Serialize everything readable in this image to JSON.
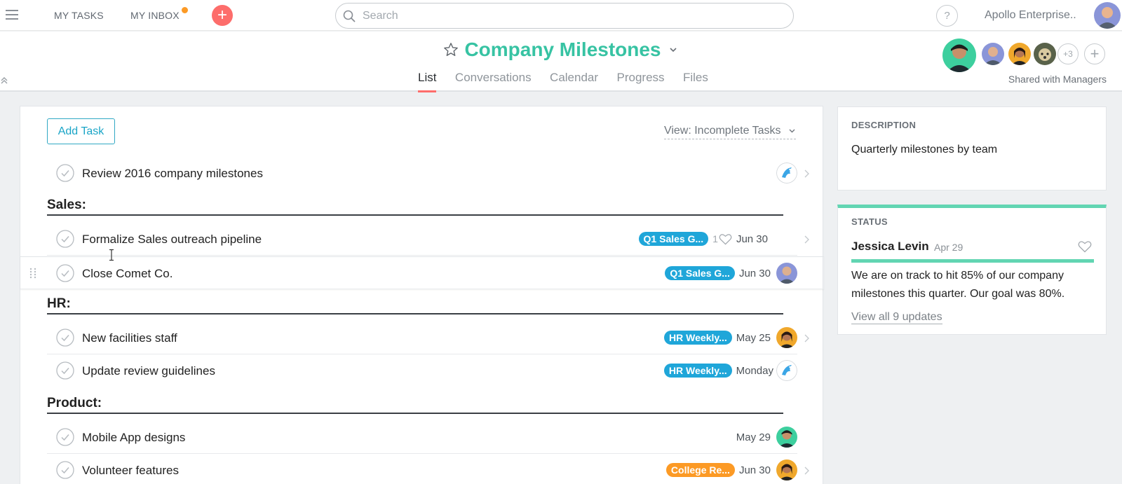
{
  "topbar": {
    "my_tasks": "MY TASKS",
    "my_inbox": "MY INBOX",
    "plus": "+",
    "search_placeholder": "Search",
    "help": "?",
    "org_name": "Apollo Enterprise.."
  },
  "project": {
    "title": "Company Milestones",
    "tabs": [
      "List",
      "Conversations",
      "Calendar",
      "Progress",
      "Files"
    ],
    "active_tab": "List",
    "more_members": "+3",
    "add_member": "+",
    "shared_with": "Shared with Managers"
  },
  "list": {
    "add_task": "Add Task",
    "view_filter": "View: Incomplete Tasks",
    "tasks": [
      {
        "name": "Review 2016 company milestones",
        "tag": "",
        "likes": "",
        "due": "",
        "assignee": "blue-bird"
      },
      {
        "name": "Formalize Sales outreach pipeline",
        "tag": "Q1 Sales G...",
        "likes": "1",
        "due": "Jun 30",
        "assignee": ""
      },
      {
        "name": "Close Comet Co.",
        "tag": "Q1 Sales G...",
        "likes": "",
        "due": "Jun 30",
        "assignee": "gray-man"
      },
      {
        "name": "New facilities staff",
        "tag": "HR Weekly...",
        "likes": "",
        "due": "May 25",
        "assignee": "woman"
      },
      {
        "name": "Update review guidelines",
        "tag": "HR Weekly...",
        "likes": "",
        "due": "Monday",
        "assignee": "blue-bird"
      },
      {
        "name": "Mobile App designs",
        "tag": "",
        "likes": "",
        "due": "May 29",
        "assignee": "green-woman"
      },
      {
        "name": "Volunteer features",
        "tag": "College Re...",
        "likes": "",
        "due": "Jun 30",
        "assignee": "woman"
      }
    ],
    "sections": [
      "Sales:",
      "HR:",
      "Product:"
    ]
  },
  "description": {
    "label": "DESCRIPTION",
    "text": "Quarterly milestones by team"
  },
  "status": {
    "label": "STATUS",
    "author": "Jessica Levin",
    "date": "Apr 29",
    "text": "We are on track to hit 85% of our company milestones this quarter. Our goal was 80%.",
    "link": "View all 9 updates"
  },
  "colors": {
    "accent": "#37c3a3",
    "tag_blue": "#1fa6d9",
    "tag_orange": "#fc9a25",
    "add_red": "#fd6d6b",
    "status_green": "#62d5b2"
  },
  "icons": [
    "hamburger-icon",
    "search-icon",
    "star-icon",
    "chevron-down-icon",
    "checkmark-icon",
    "heart-icon",
    "chevron-right-icon",
    "drag-handle-icon",
    "double-chevron-up-icon"
  ]
}
